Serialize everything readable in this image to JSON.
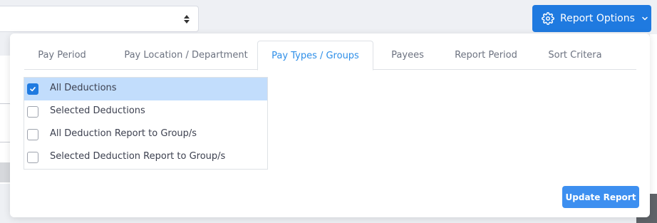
{
  "header": {
    "report_options_label": "Report Options",
    "report_options_icon": "gear-icon",
    "report_options_caret": "chevron-down-icon",
    "accent_color": "#1f7ae0"
  },
  "tabs": [
    {
      "label": "Pay Period",
      "active": false
    },
    {
      "label": "Pay Location / Department",
      "active": false
    },
    {
      "label": "Pay Types / Groups",
      "active": true
    },
    {
      "label": "Payees",
      "active": false
    },
    {
      "label": "Report Period",
      "active": false
    },
    {
      "label": "Sort Critera",
      "active": false
    }
  ],
  "options": [
    {
      "label": "All Deductions",
      "checked": true
    },
    {
      "label": "Selected Deductions",
      "checked": false
    },
    {
      "label": "All Deduction Report to Group/s",
      "checked": false
    },
    {
      "label": "Selected Deduction Report to Group/s",
      "checked": false
    }
  ],
  "update_button_label": "Update Report"
}
